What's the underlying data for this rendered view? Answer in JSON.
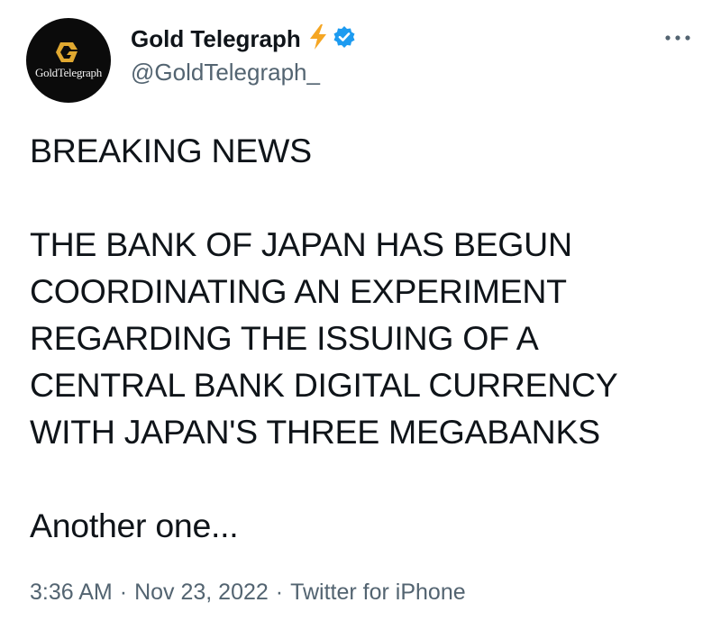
{
  "author": {
    "display_name": "Gold Telegraph",
    "handle": "@GoldTelegraph_",
    "avatar_text": "GoldTelegraph",
    "badges": [
      "lightning-bolt-icon",
      "verified-badge-icon"
    ],
    "verified_color": "#1d9bf0",
    "bolt_color": "#f5a623"
  },
  "tweet": {
    "lines": [
      "BREAKING NEWS",
      "",
      "THE BANK OF JAPAN HAS BEGUN",
      "COORDINATING AN EXPERIMENT",
      "REGARDING THE ISSUING OF A",
      "CENTRAL BANK DIGITAL CURRENCY",
      "WITH JAPAN'S THREE MEGABANKS",
      "",
      "Another one..."
    ]
  },
  "meta": {
    "time": "3:36 AM",
    "date": "Nov 23, 2022",
    "source": "Twitter for iPhone",
    "separator": "·"
  },
  "menu": {
    "more_icon": "more-horizontal-icon"
  }
}
